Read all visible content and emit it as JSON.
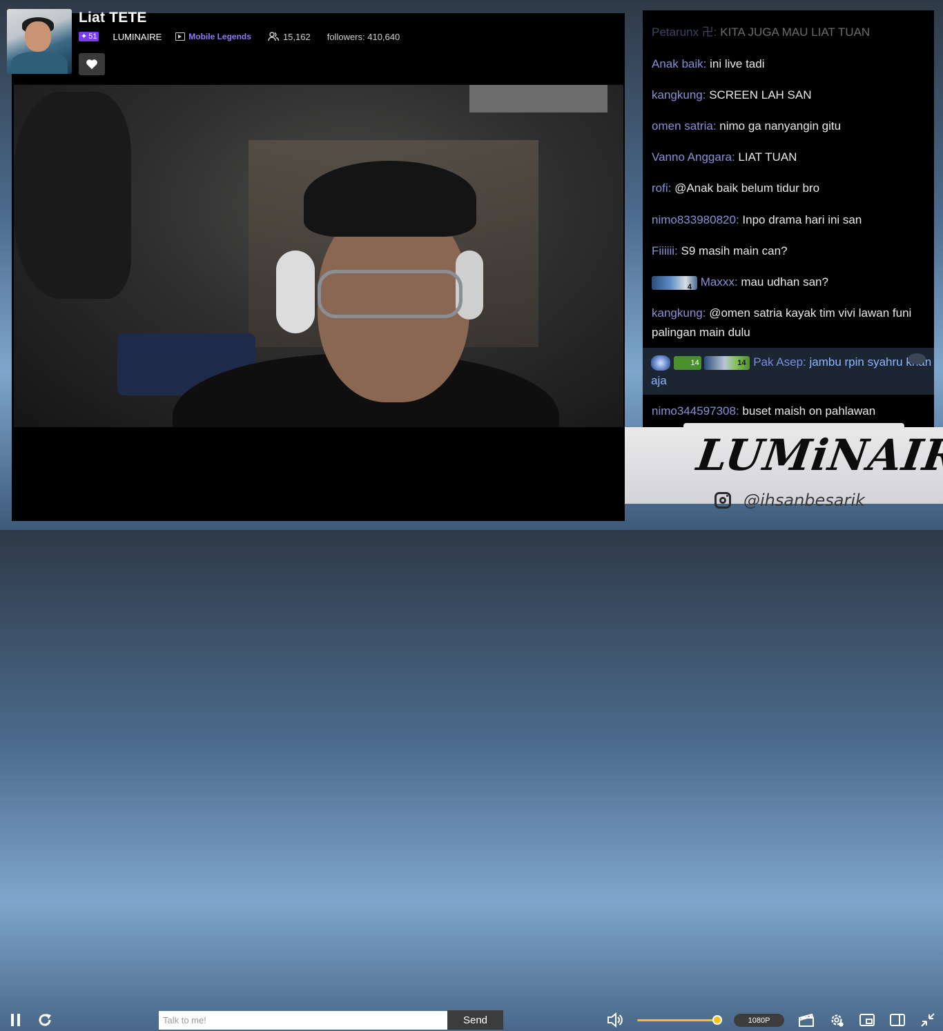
{
  "stream": {
    "title": "Liat TETE",
    "level": "51",
    "team": "LUMINAIRE",
    "game": "Mobile Legends",
    "viewers": "15,162",
    "followers": "followers: 410,640"
  },
  "chat": {
    "messages": [
      {
        "user": "Petarunx 卍:",
        "text": "KITA JUGA MAU LIAT TUAN"
      },
      {
        "user": "Anak baik:",
        "text": "ini live tadi"
      },
      {
        "user": "kangkung:",
        "text": "SCREEN LAH SAN"
      },
      {
        "user": "omen satria:",
        "text": "nimo ga nanyangin gitu"
      },
      {
        "user": "Vanno Anggara:",
        "text": "LIAT TUAN"
      },
      {
        "user": "rofi:",
        "text": "@Anak baik belum tidur bro"
      },
      {
        "user": "nimo833980820:",
        "text": "Inpo drama hari ini san"
      },
      {
        "user": "Fiiiiii:",
        "text": "S9 masih main can?"
      },
      {
        "user": "Maxxx:",
        "text": "mau udhan san?",
        "badge_level": "4"
      },
      {
        "user": "kangkung:",
        "text": "@omen satria kayak tim vivi lawan funi palingan main dulu"
      },
      {
        "user": "Pak Asep:",
        "text": "jambu rpin syahru khan aja",
        "badge_levels": [
          "14",
          "14"
        ]
      },
      {
        "user": "nimo344597308:",
        "text": "buset maish on pahlawan"
      }
    ]
  },
  "controls": {
    "chat_placeholder": "Talk to me!",
    "send_label": "Send",
    "quality": "1080P",
    "volume": 0.97
  },
  "overlay": {
    "brand": "LUMiNAIRE",
    "instagram": "@ihsanbesarik"
  },
  "colors": {
    "accent_purple": "#7a3cf0",
    "username": "#8c8fd6",
    "volume_yellow": "#f7c21b"
  }
}
